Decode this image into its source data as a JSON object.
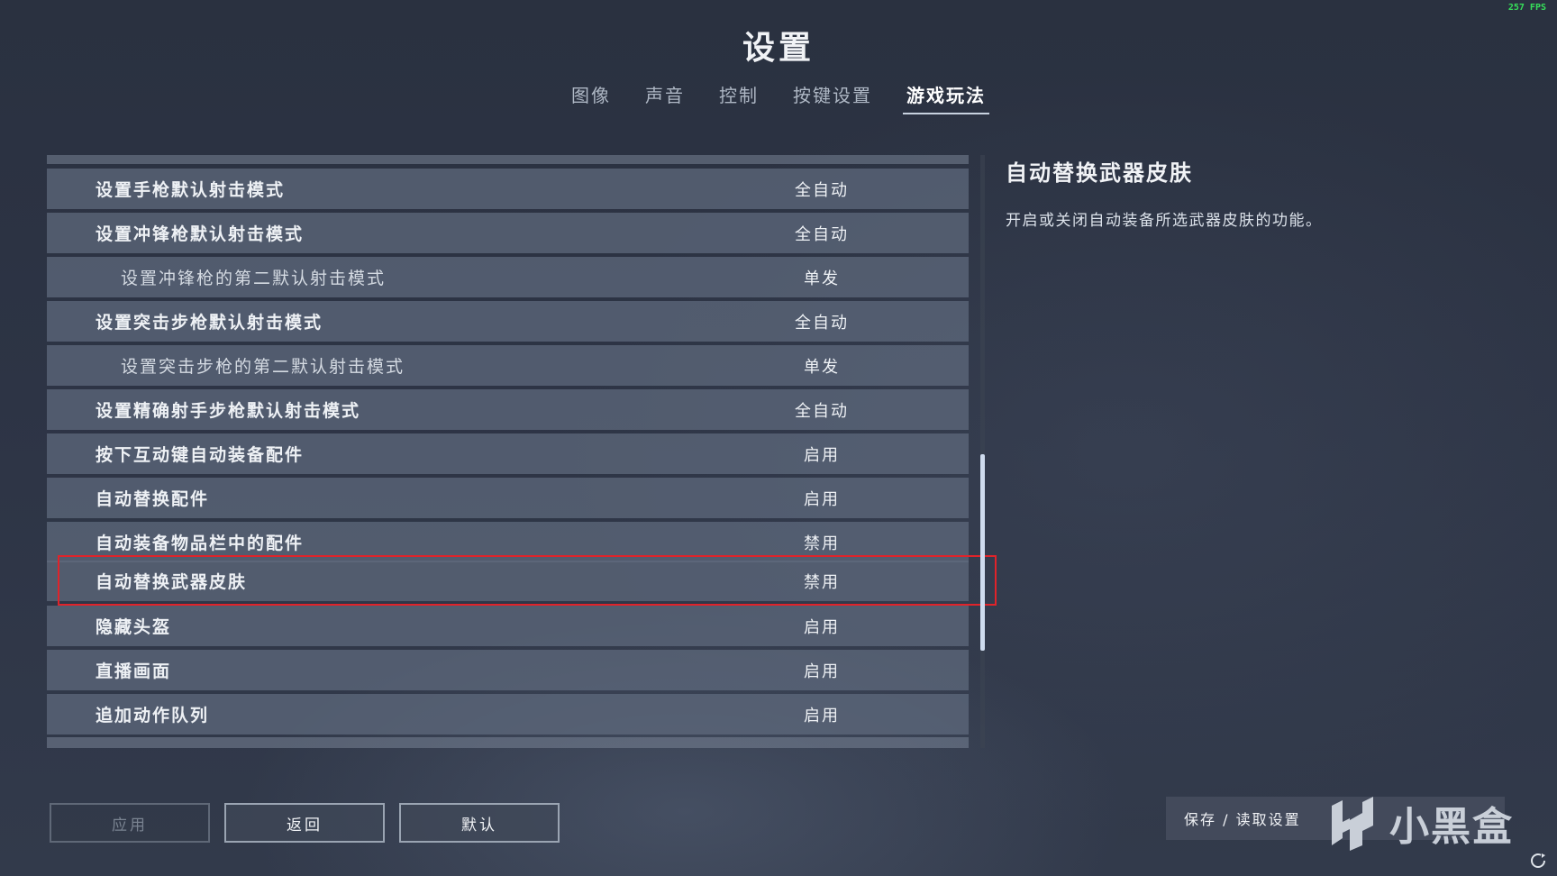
{
  "hud": {
    "fps": "257 FPS"
  },
  "header": {
    "title": "设置"
  },
  "tabs": [
    {
      "label": "图像",
      "active": false
    },
    {
      "label": "声音",
      "active": false
    },
    {
      "label": "控制",
      "active": false
    },
    {
      "label": "按键设置",
      "active": false
    },
    {
      "label": "游戏玩法",
      "active": true
    }
  ],
  "settings": [
    {
      "label": "设置手枪默认射击模式",
      "value": "全自动",
      "sub": false
    },
    {
      "label": "设置冲锋枪默认射击模式",
      "value": "全自动",
      "sub": false
    },
    {
      "label": "设置冲锋枪的第二默认射击模式",
      "value": "单发",
      "sub": true
    },
    {
      "label": "设置突击步枪默认射击模式",
      "value": "全自动",
      "sub": false
    },
    {
      "label": "设置突击步枪的第二默认射击模式",
      "value": "单发",
      "sub": true
    },
    {
      "label": "设置精确射手步枪默认射击模式",
      "value": "全自动",
      "sub": false
    },
    {
      "label": "按下互动键自动装备配件",
      "value": "启用",
      "sub": false
    },
    {
      "label": "自动替换配件",
      "value": "启用",
      "sub": false
    },
    {
      "label": "自动装备物品栏中的配件",
      "value": "禁用",
      "sub": false
    },
    {
      "label": "自动替换武器皮肤",
      "value": "禁用",
      "sub": false,
      "selected": true
    },
    {
      "label": "隐藏头盔",
      "value": "启用",
      "sub": false
    },
    {
      "label": "直播画面",
      "value": "启用",
      "sub": false
    },
    {
      "label": "追加动作队列",
      "value": "启用",
      "sub": false
    }
  ],
  "detail": {
    "title": "自动替换武器皮肤",
    "description": "开启或关闭自动装备所选武器皮肤的功能。"
  },
  "buttons": {
    "apply": "应用",
    "back": "返回",
    "default": "默认",
    "save_load": "保存 / 读取设置"
  },
  "watermark": {
    "text": "小黑盒"
  },
  "colors": {
    "highlight": "#e0232a",
    "scroll_thumb": "#cfdcef",
    "fps": "#36e05a"
  }
}
